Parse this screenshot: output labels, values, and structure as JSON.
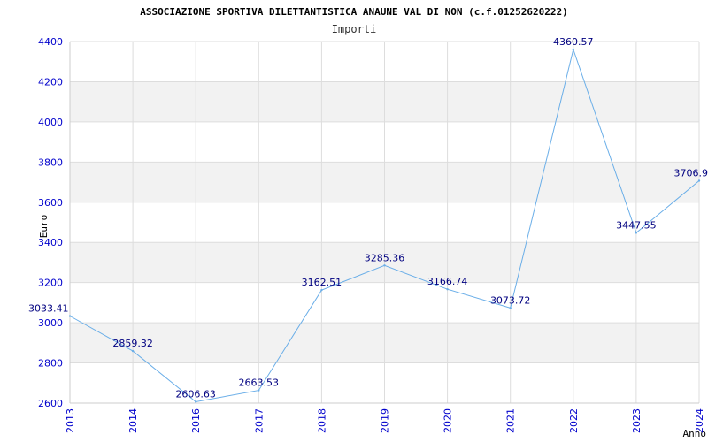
{
  "chart_data": {
    "type": "line",
    "title": "ASSOCIAZIONE SPORTIVA DILETTANTISTICA ANAUNE VAL DI NON (c.f.01252620222)",
    "subtitle": "Importi",
    "xlabel": "Anno",
    "ylabel": "Euro",
    "categories": [
      "2013",
      "2014",
      "2016",
      "2017",
      "2018",
      "2019",
      "2020",
      "2021",
      "2022",
      "2023",
      "2024"
    ],
    "series": [
      {
        "values": [
          3033.41,
          2859.32,
          2606.63,
          2663.53,
          3162.51,
          3285.36,
          3166.74,
          3073.72,
          4360.57,
          3447.55,
          3706.9
        ]
      }
    ],
    "data_labels": [
      "3033.41",
      "2859.32",
      "2606.63",
      "2663.53",
      "3162.51",
      "3285.36",
      "3166.74",
      "3073.72",
      "4360.57",
      "3447.55",
      "3706.9"
    ],
    "y_ticks": [
      2600,
      2800,
      3000,
      3200,
      3400,
      3600,
      3800,
      4000,
      4200,
      4400
    ],
    "ylim": [
      2600,
      4400
    ],
    "grid": true,
    "legend": "none",
    "colors": {
      "line": "#6aaee8",
      "tick_text": "#0000cc",
      "data_label": "#000080",
      "band": "#f2f2f2",
      "grid": "#dddddd",
      "axis": "#cccccc"
    }
  }
}
